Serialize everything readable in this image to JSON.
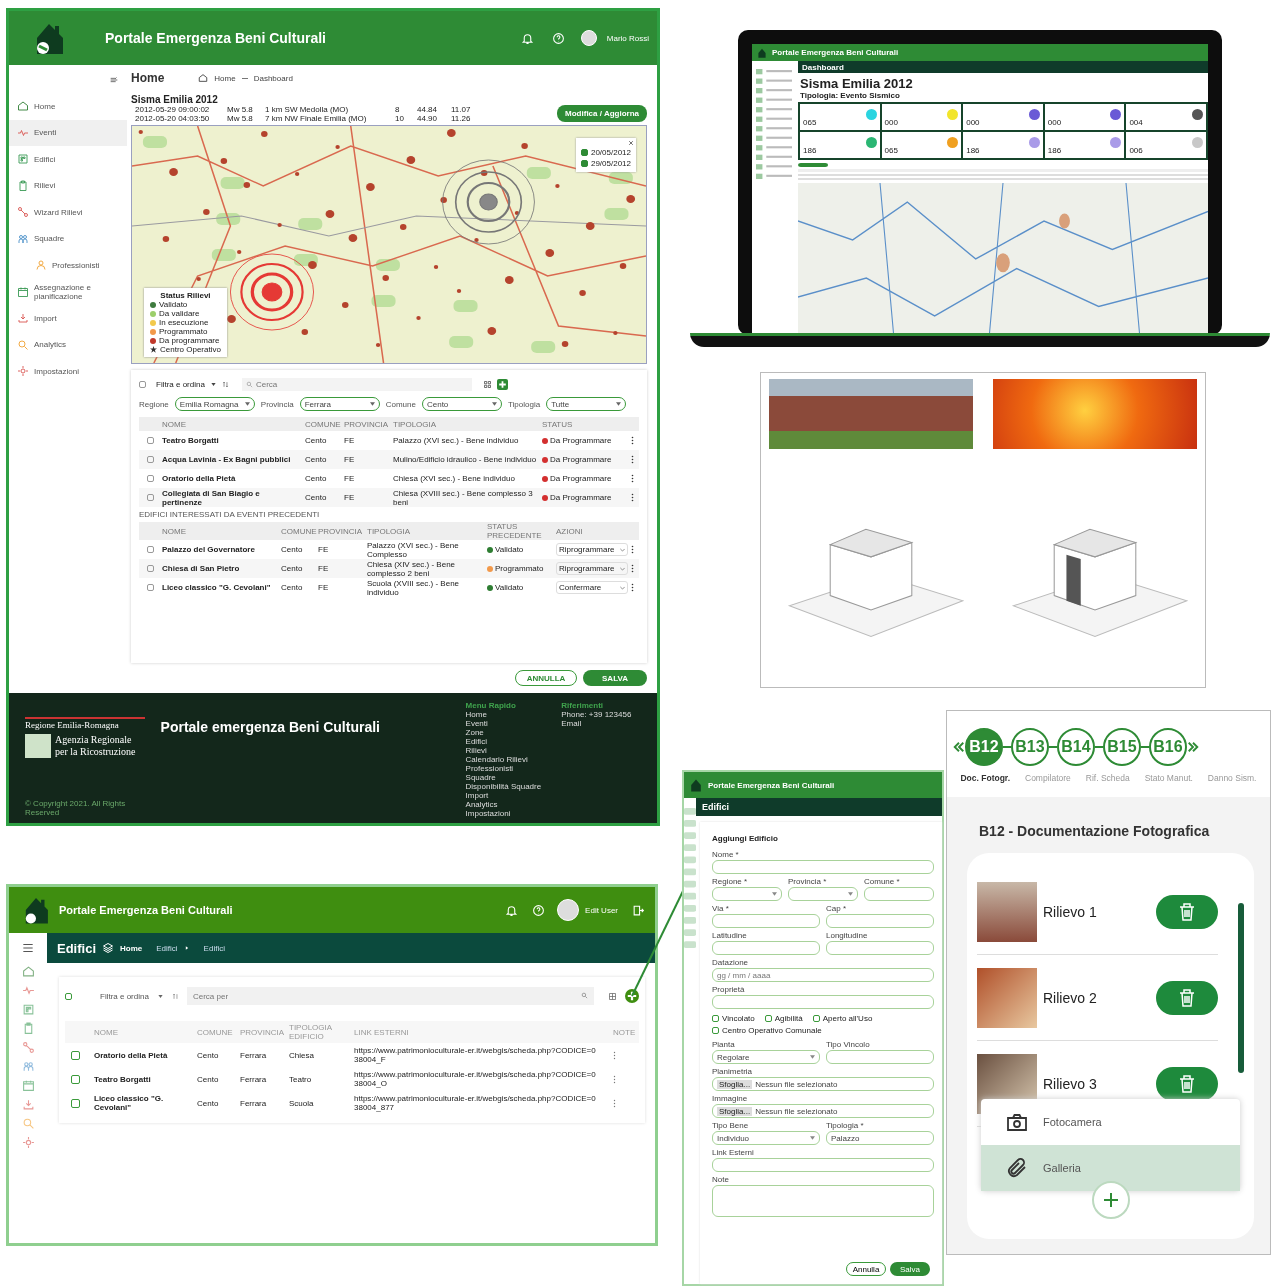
{
  "main_window": {
    "header": {
      "title": "Portale Emergenza Beni Culturali",
      "user": "Mario Rossi"
    },
    "page_title": "Home",
    "breadcrumb": [
      "Home",
      "Dashboard"
    ],
    "sidebar": {
      "items": [
        {
          "label": "Home",
          "selected": false
        },
        {
          "label": "Eventi",
          "selected": true
        },
        {
          "label": "Edifici",
          "selected": false
        },
        {
          "label": "Rilievi",
          "selected": false
        },
        {
          "label": "Wizard Rilievi",
          "selected": false
        },
        {
          "label": "Squadre",
          "selected": false,
          "children": [
            {
              "label": "Professionisti",
              "selected": false
            }
          ]
        },
        {
          "label": "Assegnazione e pianificazione",
          "selected": false
        },
        {
          "label": "Import",
          "selected": false
        },
        {
          "label": "Analytics",
          "selected": false
        },
        {
          "label": "Impostazioni",
          "selected": false
        }
      ]
    },
    "event": {
      "title": "Sisma Emilia 2012",
      "edit_button": "Modifica / Aggiorna",
      "rows": [
        [
          "2012-05-29 09:00:02",
          "Mw 5.8",
          "1 km SW Medolla (MO)",
          "8",
          "44.84",
          "11.07"
        ],
        [
          "2012-05-20 04:03:50",
          "Mw 5.8",
          "7 km NW Finale Emilia (MO)",
          "10",
          "44.90",
          "11.26"
        ]
      ]
    },
    "map": {
      "dates": [
        {
          "label": "20/05/2012",
          "checked": true
        },
        {
          "label": "29/05/2012",
          "checked": true
        }
      ],
      "legend": {
        "title": "Status Rilievi",
        "items": [
          {
            "label": "Validato",
            "kind": "dot",
            "color": "#3e7b3e"
          },
          {
            "label": "Da validare",
            "kind": "dot",
            "color": "#9ccf6b"
          },
          {
            "label": "In esecuzione",
            "kind": "dot",
            "color": "#f2c94c"
          },
          {
            "label": "Programmato",
            "kind": "dot",
            "color": "#f2994a"
          },
          {
            "label": "Da programmare",
            "kind": "dot",
            "color": "#c0392b"
          },
          {
            "label": "Centro Operativo",
            "kind": "star"
          }
        ]
      }
    },
    "toolbar": {
      "select_all_checked": false,
      "filter": "Filtra e ordina",
      "search_placeholder": "Cerca"
    },
    "filters": [
      {
        "label": "Regione",
        "value": "Emilia Romagna"
      },
      {
        "label": "Provincia",
        "value": "Ferrara"
      },
      {
        "label": "Comune",
        "value": "Cento"
      },
      {
        "label": "Tipologia",
        "value": "Tutte"
      }
    ],
    "table": {
      "columns": [
        "NOME",
        "COMUNE",
        "PROVINCIA",
        "TIPOLOGIA",
        "STATUS"
      ],
      "rows": [
        {
          "checked": false,
          "cells": [
            "Teatro Borgatti",
            "Cento",
            "FE",
            "Palazzo (XVI sec.) - Bene individuo"
          ],
          "status": "Da Programmare",
          "color": "#d32f2f"
        },
        {
          "checked": false,
          "cells": [
            "Acqua Lavinia - Ex Bagni pubblici",
            "Cento",
            "FE",
            "Mulino/Edificio idraulico - Bene individuo"
          ],
          "status": "Da Programmare",
          "color": "#d32f2f"
        },
        {
          "checked": false,
          "cells": [
            "Oratorio della Pietà",
            "Cento",
            "FE",
            "Chiesa (XVI sec.) - Bene individuo"
          ],
          "status": "Da Programmare",
          "color": "#d32f2f"
        },
        {
          "checked": false,
          "cells": [
            "Collegiata di San Biagio e pertinenze",
            "Cento",
            "FE",
            "Chiesa (XVIII sec.) - Bene complesso 3 beni"
          ],
          "status": "Da Programmare",
          "color": "#d32f2f"
        }
      ]
    },
    "section_title": "EDIFICI INTERESSATI DA EVENTI PRECEDENTI",
    "table_previous": {
      "columns": [
        "NOME",
        "COMUNE",
        "PROVINCIA",
        "TIPOLOGIA",
        "STATUS PRECEDENTE",
        "AZIONI"
      ],
      "rows": [
        {
          "checked": false,
          "cells": [
            "Palazzo del Governatore",
            "Cento",
            "FE",
            "Palazzo (XVI sec.) - Bene Complesso"
          ],
          "status": "Validato",
          "color": "#2e7d32",
          "action": "Riprogrammare"
        },
        {
          "checked": false,
          "cells": [
            "Chiesa di San Pietro",
            "Cento",
            "FE",
            "Chiesa (XIV sec.) - Bene complesso 2 beni"
          ],
          "status": "Programmato",
          "color": "#f2994a",
          "action": "Riprogrammare"
        },
        {
          "checked": false,
          "cells": [
            "Liceo classico \"G. Cevolani\"",
            "Cento",
            "FE",
            "Scuola (XVIII sec.) - Bene individuo"
          ],
          "status": "Validato",
          "color": "#2e7d32",
          "action": "Confermare"
        }
      ]
    },
    "cancel_button": "ANNULLA",
    "save_button": "SALVA",
    "footer": {
      "logo_region": "Regione Emilia-Romagna",
      "logo_agency": "Agenzia Regionale per la Ricostruzione",
      "title": "Portale emergenza Beni Culturali",
      "copyright": "© Copyright 2021. All Rights Reserved",
      "menu_title": "Menu Rapido",
      "menu": [
        "Home",
        "Eventi",
        "Zone",
        "Edifici",
        "Rilievi",
        "Calendario Rilievi",
        "Professionisti",
        "Squadre",
        "Disponibilità Squadre",
        "Import",
        "Analytics",
        "Impostazioni"
      ],
      "contacts_title": "Riferimenti",
      "contacts": [
        "Phone: +39 123456",
        "Email"
      ]
    }
  },
  "laptop_screen": {
    "header_title": "Portale Emergenza Beni Culturali",
    "page": "Dashboard",
    "title": "Sisma Emilia 2012",
    "subtitle": "Tipologia: Evento Sismico",
    "stats": [
      {
        "value": "065",
        "color": "#2ad4e0"
      },
      {
        "value": "000",
        "color": "#f2e52a"
      },
      {
        "value": "000",
        "color": "#6a5ad6"
      },
      {
        "value": "000",
        "color": "#6a5ad6"
      },
      {
        "value": "004",
        "color": "#555555"
      },
      {
        "value": "186",
        "color": "#2bb673"
      },
      {
        "value": "065",
        "color": "#f0a020"
      },
      {
        "value": "186",
        "color": "#a99be8"
      },
      {
        "value": "186",
        "color": "#a99be8"
      },
      {
        "value": "006",
        "color": "#c8c8c8"
      }
    ]
  },
  "edifici_screen": {
    "header_title": "Portale Emergenza Beni Culturali",
    "user": "Edit User",
    "page": "Edifici",
    "breadcrumb": [
      "Home",
      "Edifici",
      "Edifici"
    ],
    "select_all_checked": false,
    "filter": "Filtra e ordina",
    "search_placeholder": "Cerca per",
    "columns": [
      "NOME",
      "COMUNE",
      "PROVINCIA",
      "TIPOLOGIA EDIFICIO",
      "LINK ESTERNI",
      "NOTE"
    ],
    "rows": [
      {
        "checked": false,
        "cells": [
          "Oratorio della Pietà",
          "Cento",
          "Ferrara",
          "Chiesa",
          "https://www.patrimonioculturale-er.it/webgis/scheda.php?CODICE=038004_F"
        ]
      },
      {
        "checked": false,
        "cells": [
          "Teatro Borgatti",
          "Cento",
          "Ferrara",
          "Teatro",
          "https://www.patrimonioculturale-er.it/webgis/scheda.php?CODICE=038004_O"
        ]
      },
      {
        "checked": false,
        "cells": [
          "Liceo classico \"G. Cevolani\"",
          "Cento",
          "Ferrara",
          "Scuola",
          "https://www.patrimonioculturale-er.it/webgis/scheda.php?CODICE=038004_877"
        ]
      }
    ]
  },
  "form_screen": {
    "header_title": "Portale Emergenza Beni Culturali",
    "page": "Edifici",
    "form_title": "Aggiungi Edificio",
    "rows": [
      [
        {
          "label": "Nome *"
        }
      ],
      [
        {
          "label": "Regione *",
          "kind": "select"
        },
        {
          "label": "Provincia *",
          "kind": "select"
        },
        {
          "label": "Comune *"
        }
      ],
      [
        {
          "label": "Via *"
        },
        {
          "label": "Cap *"
        }
      ],
      [
        {
          "label": "Latitudine"
        },
        {
          "label": "Longitudine"
        }
      ],
      [
        {
          "label": "Datazione",
          "placeholder": "gg / mm / aaaa"
        }
      ],
      [
        {
          "label": "Proprietà"
        }
      ]
    ],
    "checkboxes": [
      {
        "label": "Vincolato",
        "checked": false
      },
      {
        "label": "Agibilità",
        "checked": false
      },
      {
        "label": "Aperto all'Uso",
        "checked": false
      },
      {
        "label": "Centro Operativo Comunale",
        "checked": false
      }
    ],
    "rows2": [
      [
        {
          "label": "Pianta",
          "kind": "select",
          "value": "Regolare"
        },
        {
          "label": "Tipo Vincolo"
        }
      ],
      [
        {
          "label": "Planimetria",
          "kind": "file",
          "button": "Sfoglia...",
          "value": "Nessun file selezionato"
        }
      ],
      [
        {
          "label": "Immagine",
          "kind": "file",
          "button": "Sfoglia...",
          "value": "Nessun file selezionato"
        }
      ],
      [
        {
          "label": "Tipo Bene",
          "kind": "select",
          "value": "Individuo"
        },
        {
          "label": "Tipologia *",
          "value": "Palazzo"
        }
      ],
      [
        {
          "label": "Link Esterni"
        }
      ],
      [
        {
          "label": "Note",
          "kind": "area"
        }
      ]
    ],
    "cancel_button": "Annulla",
    "save_button": "Salva"
  },
  "mobile_screen": {
    "steps": [
      {
        "code": "B12",
        "label": "Doc. Fotogr.",
        "selected": true
      },
      {
        "code": "B13",
        "label": "Compilatore",
        "selected": false
      },
      {
        "code": "B14",
        "label": "Rif. Scheda",
        "selected": false
      },
      {
        "code": "B15",
        "label": "Stato Manut.",
        "selected": false
      },
      {
        "code": "B16",
        "label": "Danno Sism.",
        "selected": false
      }
    ],
    "heading": "B12 - Documentazione Fotografica",
    "items": [
      "Rilievo 1",
      "Rilievo 2",
      "Rilievo 3"
    ],
    "menu": [
      {
        "label": "Fotocamera",
        "kind": "camera",
        "selected": false
      },
      {
        "label": "Galleria",
        "kind": "attachment",
        "selected": true
      }
    ]
  }
}
